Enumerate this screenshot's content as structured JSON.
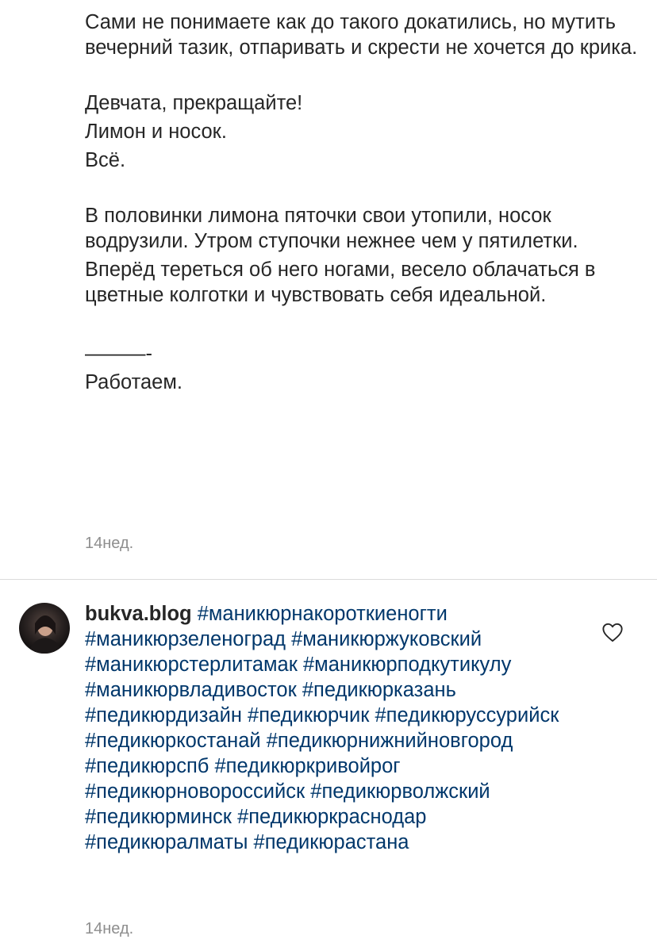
{
  "post": {
    "paragraph1": "Сами не понимаете как до такого докатились, но мутить вечерний тазик, отпаривать и скрести не хочется до крика.",
    "line1": "Девчата, прекращайте!",
    "line2": "Лимон и носок.",
    "line3": "Всё.",
    "paragraph2": "В половинки лимона пяточки свои утопили, носок водрузили. Утром ступочки нежнее чем у пятилетки.",
    "paragraph3": "Вперёд тереться об него ногами, весело облачаться в цветные колготки и чувствовать себя идеальной.",
    "dashes": "———-",
    "closing": "Работаем.",
    "time": "14нед."
  },
  "comment": {
    "username": "bukva.blog",
    "hashtags": [
      "#маникюрнакороткиеногти",
      "#маникюрзеленоград",
      "#маникюржуковский",
      "#маникюрстерлитамак",
      "#маникюрподкутикулу",
      "#маникюрвладивосток",
      "#педикюрказань",
      "#педикюрдизайн",
      "#педикюрчик",
      "#педикюруссурийск",
      "#педикюркостанай",
      "#педикюрнижнийновгород",
      "#педикюрспб",
      "#педикюркривойрог",
      "#педикюрновороссийск",
      "#педикюрволжский",
      "#педикюрминск",
      "#педикюркраснодар",
      "#педикюралматы",
      "#педикюрастана"
    ],
    "time": "14нед.",
    "like_icon": "heart-icon",
    "avatar_icon": "avatar"
  },
  "colors": {
    "text": "#262626",
    "hashtag": "#00376b",
    "meta": "#8e8e8e",
    "divider": "#dbdbdb"
  }
}
